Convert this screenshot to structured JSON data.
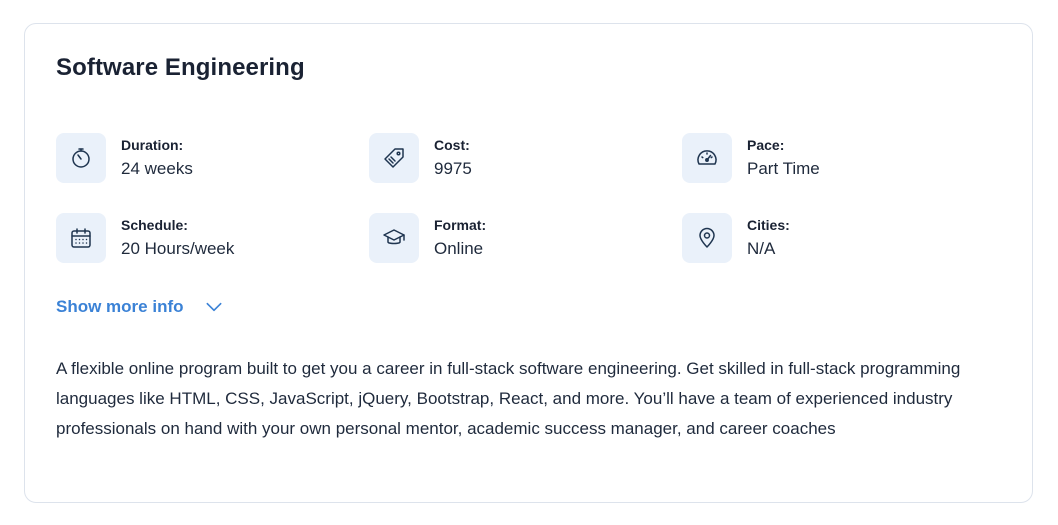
{
  "card": {
    "title": "Software Engineering",
    "details": [
      {
        "label": "Duration:",
        "value": "24 weeks",
        "icon": "timer-icon"
      },
      {
        "label": "Cost:",
        "value": "9975",
        "icon": "price-tag-icon"
      },
      {
        "label": "Pace:",
        "value": "Part Time",
        "icon": "speedometer-icon"
      },
      {
        "label": "Schedule:",
        "value": "20 Hours/week",
        "icon": "calendar-icon"
      },
      {
        "label": "Format:",
        "value": "Online",
        "icon": "graduation-cap-icon"
      },
      {
        "label": "Cities:",
        "value": "N/A",
        "icon": "map-pin-icon"
      }
    ],
    "show_more_label": "Show more info",
    "description": "A flexible online program built to get you a career in full-stack software engineering. Get skilled in full-stack programming languages like HTML, CSS, JavaScript, jQuery, Bootstrap, React, and more. You’ll have a team of experienced industry professionals on hand with your own personal mentor, academic success manager, and career coaches"
  },
  "colors": {
    "accent": "#3b82d6",
    "icon_bg": "#eaf1fa",
    "border": "#dde3ec",
    "text": "#1a2233"
  }
}
